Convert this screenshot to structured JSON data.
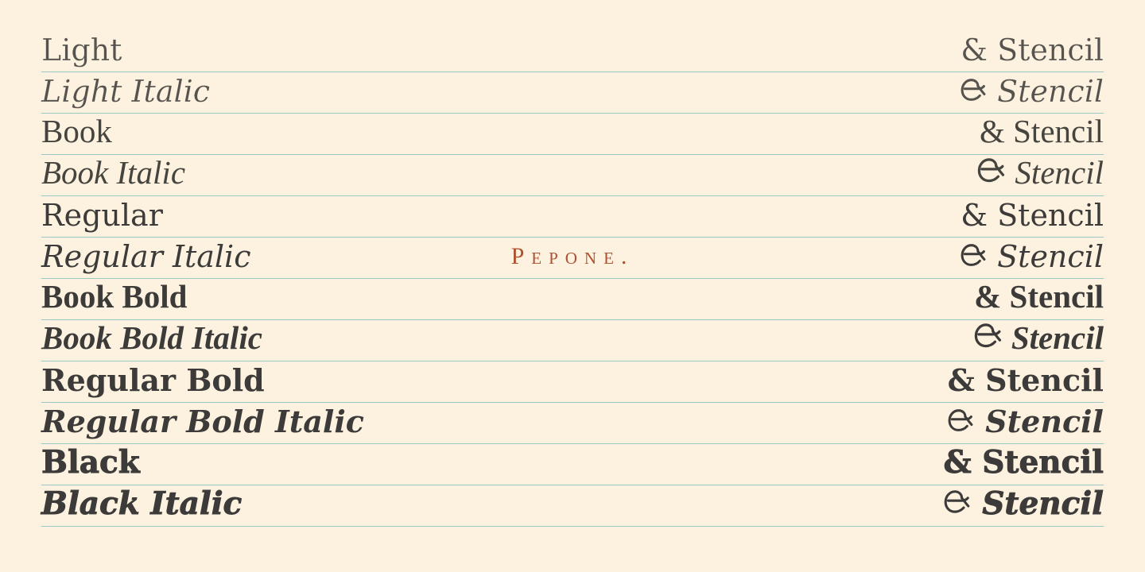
{
  "specimen": {
    "background_color": "#FDF2DF",
    "text_color": "#3C3B3A",
    "rule_color": "#9CC6C4",
    "accent_color": "#B05030",
    "wordmark": "Pepone.",
    "stencil_word": "Stencil",
    "ampersand_upright": "&",
    "ampersand_italic": "&",
    "rows": [
      {
        "style_name": "Light",
        "stencil": "& Stencil"
      },
      {
        "style_name": "Light Italic",
        "stencil": "& Stencil"
      },
      {
        "style_name": "Book",
        "stencil": "& Stencil"
      },
      {
        "style_name": "Book Italic",
        "stencil": "& Stencil"
      },
      {
        "style_name": "Regular",
        "stencil": "& Stencil"
      },
      {
        "style_name": "Regular Italic",
        "stencil": "& Stencil"
      },
      {
        "style_name": "Book Bold",
        "stencil": "& Stencil"
      },
      {
        "style_name": "Book Bold Italic",
        "stencil": "& Stencil"
      },
      {
        "style_name": "Regular Bold",
        "stencil": "& Stencil"
      },
      {
        "style_name": "Regular Bold Italic",
        "stencil": "& Stencil"
      },
      {
        "style_name": "Black",
        "stencil": "& Stencil"
      },
      {
        "style_name": "Black Italic",
        "stencil": "& Stencil"
      }
    ]
  }
}
